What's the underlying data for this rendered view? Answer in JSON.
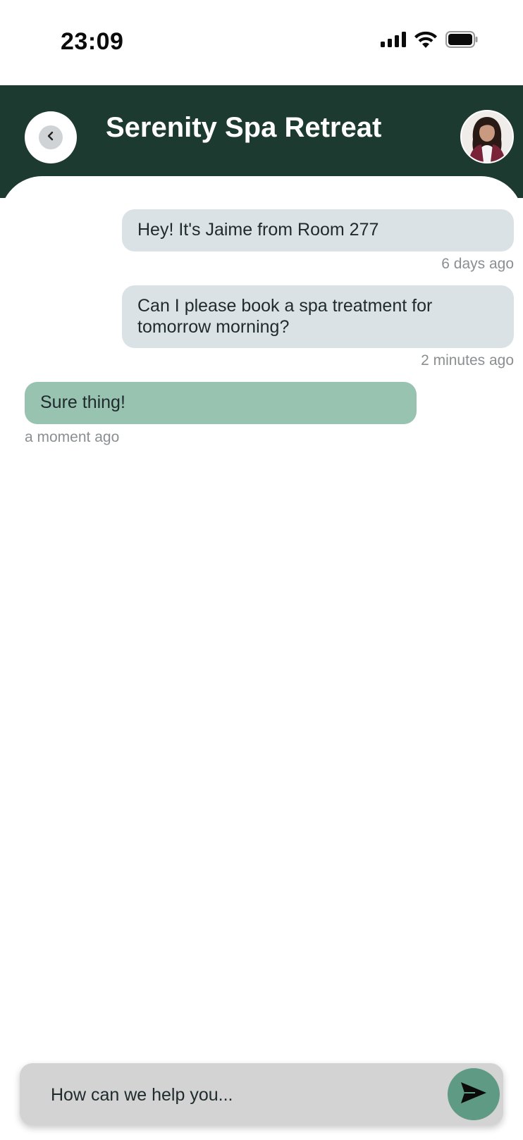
{
  "status_bar": {
    "time": "23:09",
    "icons": [
      "cellular-signal-icon",
      "wifi-icon",
      "battery-icon"
    ]
  },
  "header": {
    "title": "Serenity Spa Retreat",
    "background_color": "#1d3a30",
    "back_icon": "chevron-left-icon",
    "avatar": "staff-avatar"
  },
  "messages": [
    {
      "direction": "outgoing",
      "text": "Hey! It's Jaime from Room 277",
      "time": "6 days ago"
    },
    {
      "direction": "outgoing",
      "text": "Can I please book a spa treatment for tomorrow morning?",
      "time": "2 minutes ago"
    },
    {
      "direction": "incoming",
      "text": "Sure thing!",
      "time": "a moment ago"
    }
  ],
  "composer": {
    "placeholder": "How can we help you...",
    "send_icon": "send-icon",
    "accent_color": "#5f9b84"
  },
  "colors": {
    "outgoing_bubble": "#dbe2e6",
    "incoming_bubble": "#99c3b1"
  }
}
